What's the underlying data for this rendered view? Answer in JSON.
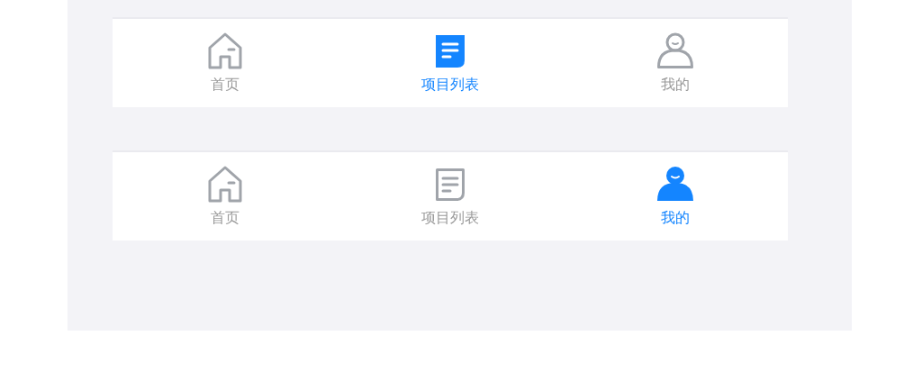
{
  "tab_bars": [
    {
      "tabs": [
        {
          "kind": "home",
          "label": "首页",
          "selected": false
        },
        {
          "kind": "list",
          "label": "项目列表",
          "selected": true
        },
        {
          "kind": "user",
          "label": "我的",
          "selected": false
        }
      ]
    },
    {
      "tabs": [
        {
          "kind": "home",
          "label": "首页",
          "selected": false
        },
        {
          "kind": "list",
          "label": "项目列表",
          "selected": false
        },
        {
          "kind": "user",
          "label": "我的",
          "selected": true
        }
      ]
    }
  ]
}
